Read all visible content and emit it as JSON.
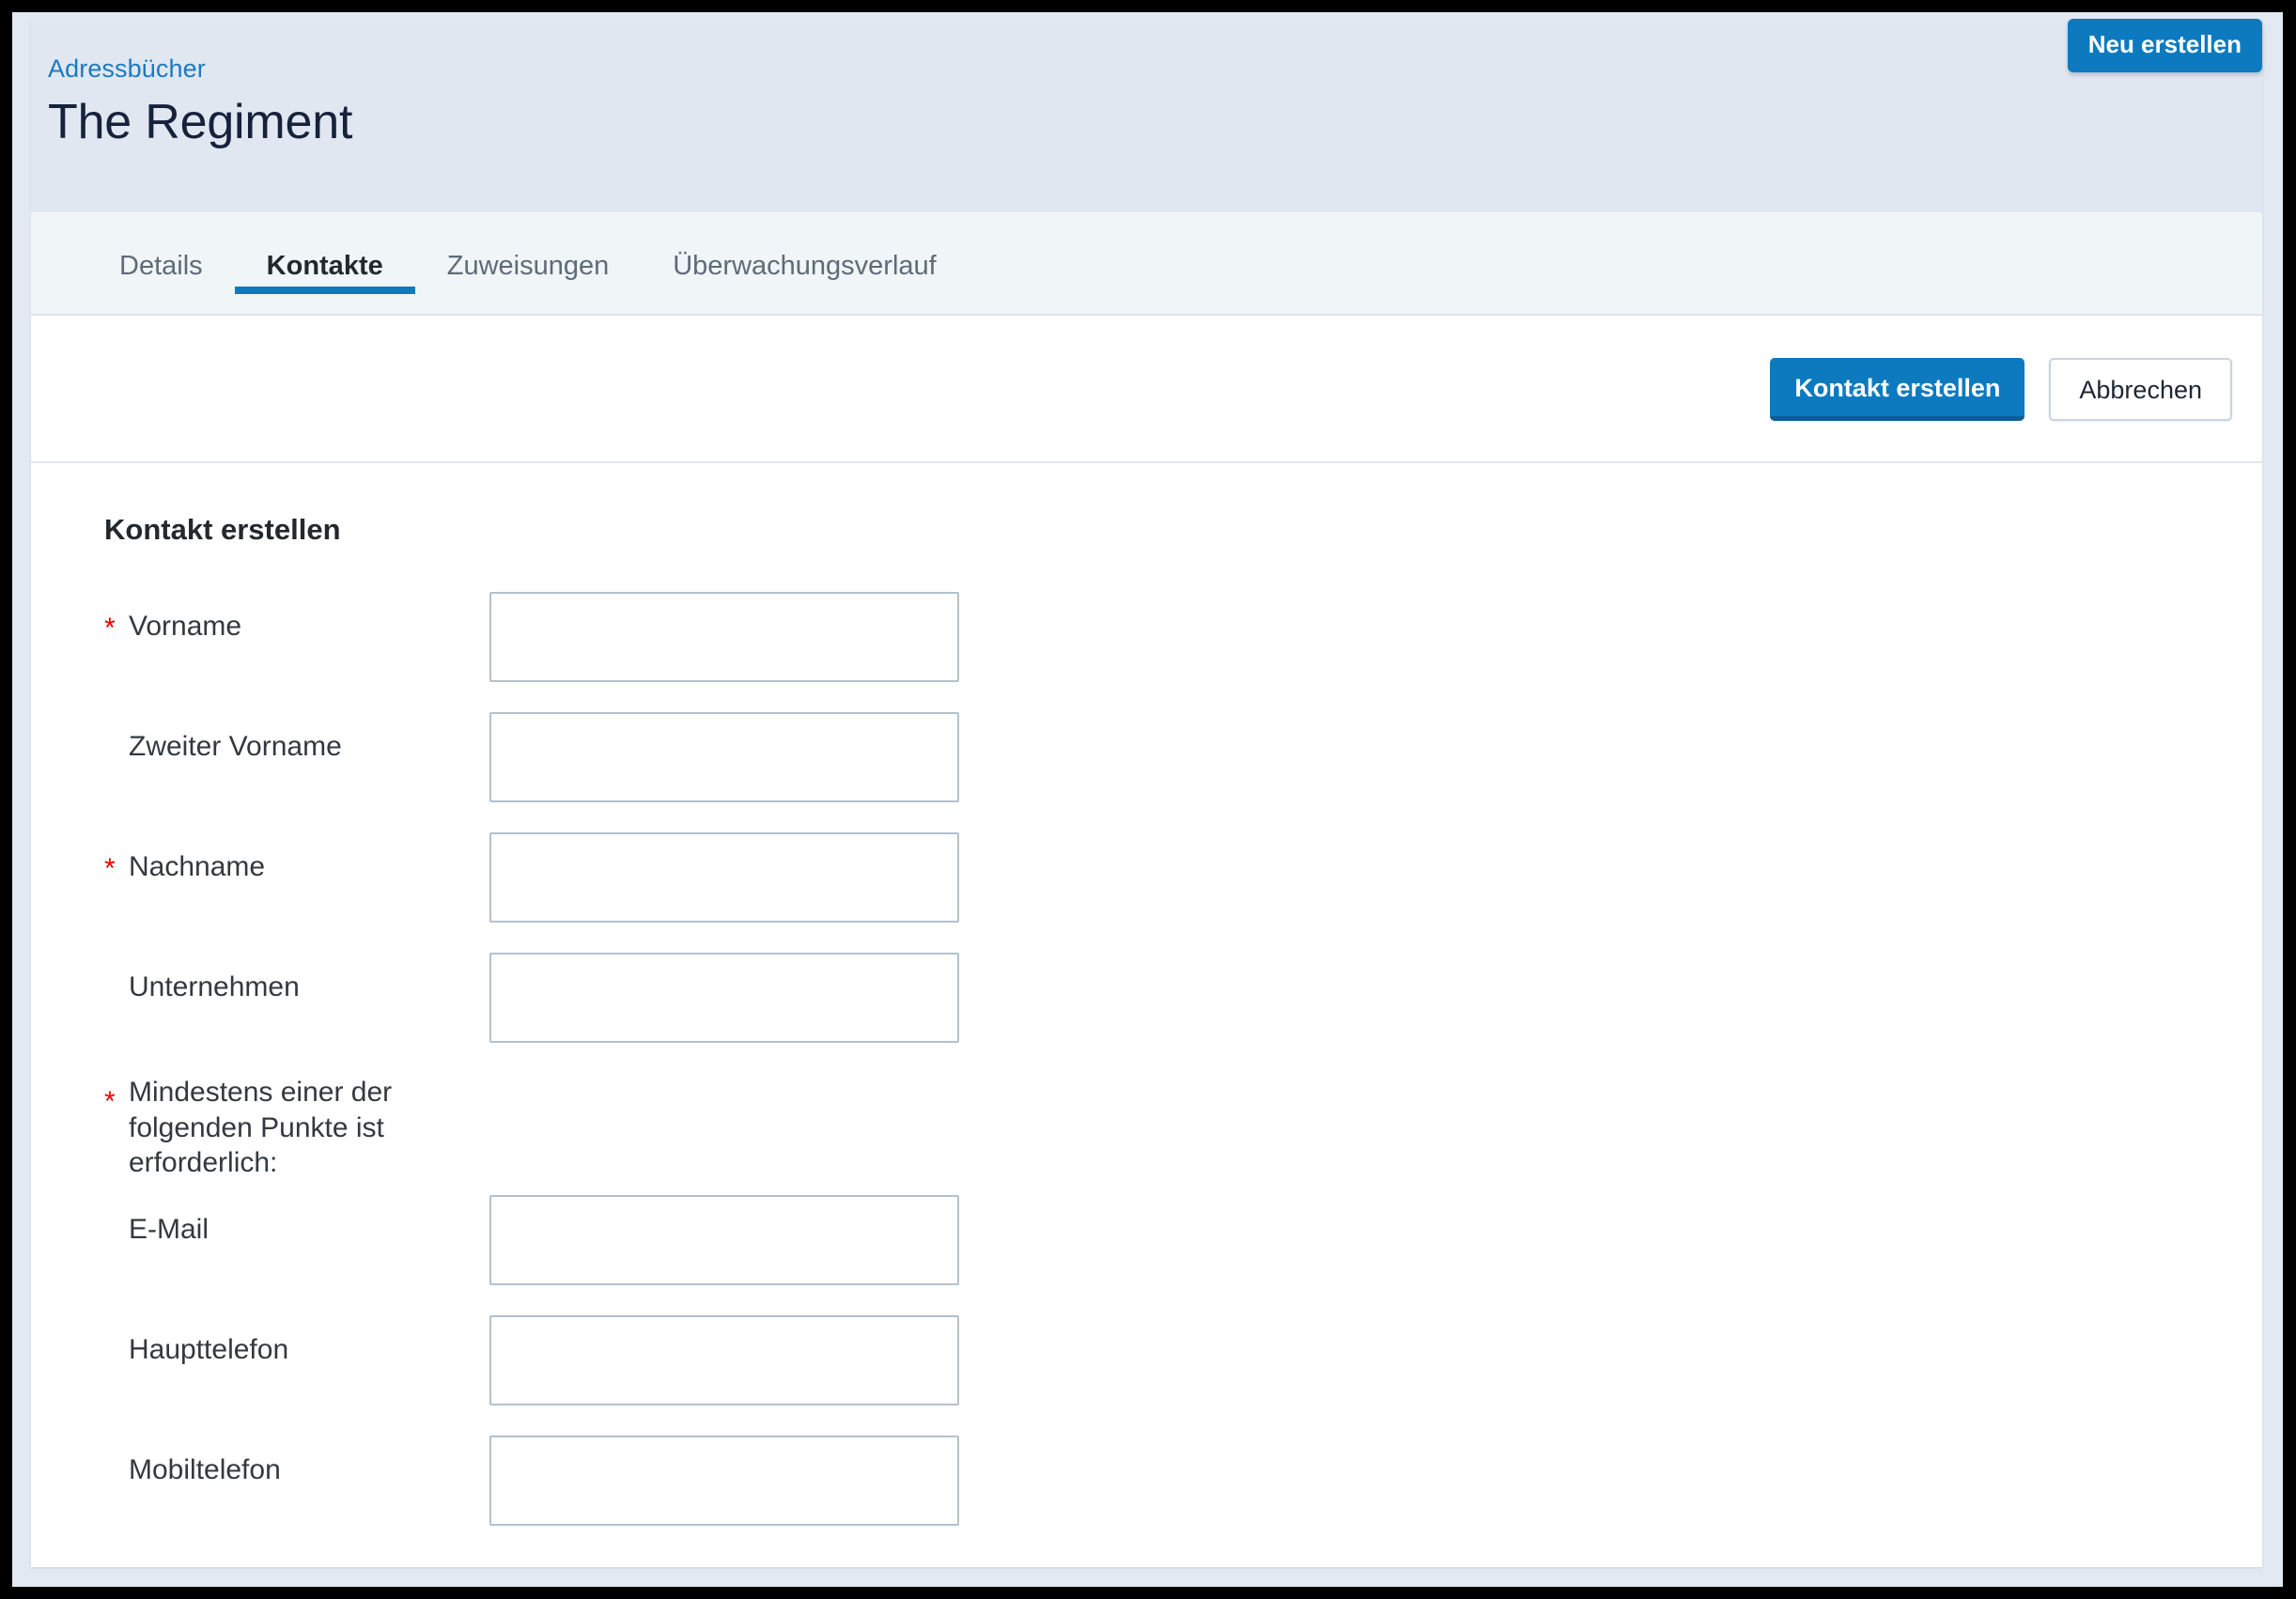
{
  "topbar": {
    "create_new_label": "Neu erstellen"
  },
  "header": {
    "breadcrumb": "Adressbücher",
    "title": "The Regiment"
  },
  "tabs": [
    {
      "label": "Details",
      "active": false
    },
    {
      "label": "Kontakte",
      "active": true
    },
    {
      "label": "Zuweisungen",
      "active": false
    },
    {
      "label": "Überwachungsverlauf",
      "active": false
    }
  ],
  "toolbar": {
    "submit_label": "Kontakt erstellen",
    "cancel_label": "Abbrechen"
  },
  "form": {
    "heading": "Kontakt erstellen",
    "required_marker": "*",
    "fields": [
      {
        "label": "Vorname",
        "required": true,
        "value": "",
        "placeholder": "",
        "type": "input"
      },
      {
        "label": "Zweiter Vorname",
        "required": false,
        "value": "",
        "placeholder": "",
        "type": "input"
      },
      {
        "label": "Nachname",
        "required": true,
        "value": "",
        "placeholder": "",
        "type": "input"
      },
      {
        "label": "Unternehmen",
        "required": false,
        "value": "",
        "placeholder": "",
        "type": "input"
      },
      {
        "label": "Mindestens einer der folgenden Punkte ist erforderlich:",
        "required": true,
        "type": "note"
      },
      {
        "label": "E-Mail",
        "required": false,
        "value": "",
        "placeholder": "",
        "type": "input"
      },
      {
        "label": "Haupttelefon",
        "required": false,
        "value": "",
        "placeholder": "",
        "type": "input"
      },
      {
        "label": "Mobiltelefon",
        "required": false,
        "value": "",
        "placeholder": "",
        "type": "input"
      }
    ]
  },
  "colors": {
    "accent_blue": "#0d7ac0",
    "link_blue": "#1b7ac2",
    "title_navy": "#16213c",
    "required_red": "#ee0000",
    "header_band": "#e0e7f0",
    "tab_strip": "#f0f5f8",
    "page_bg": "#e3e9f2",
    "input_border": "#b3c1cd"
  }
}
